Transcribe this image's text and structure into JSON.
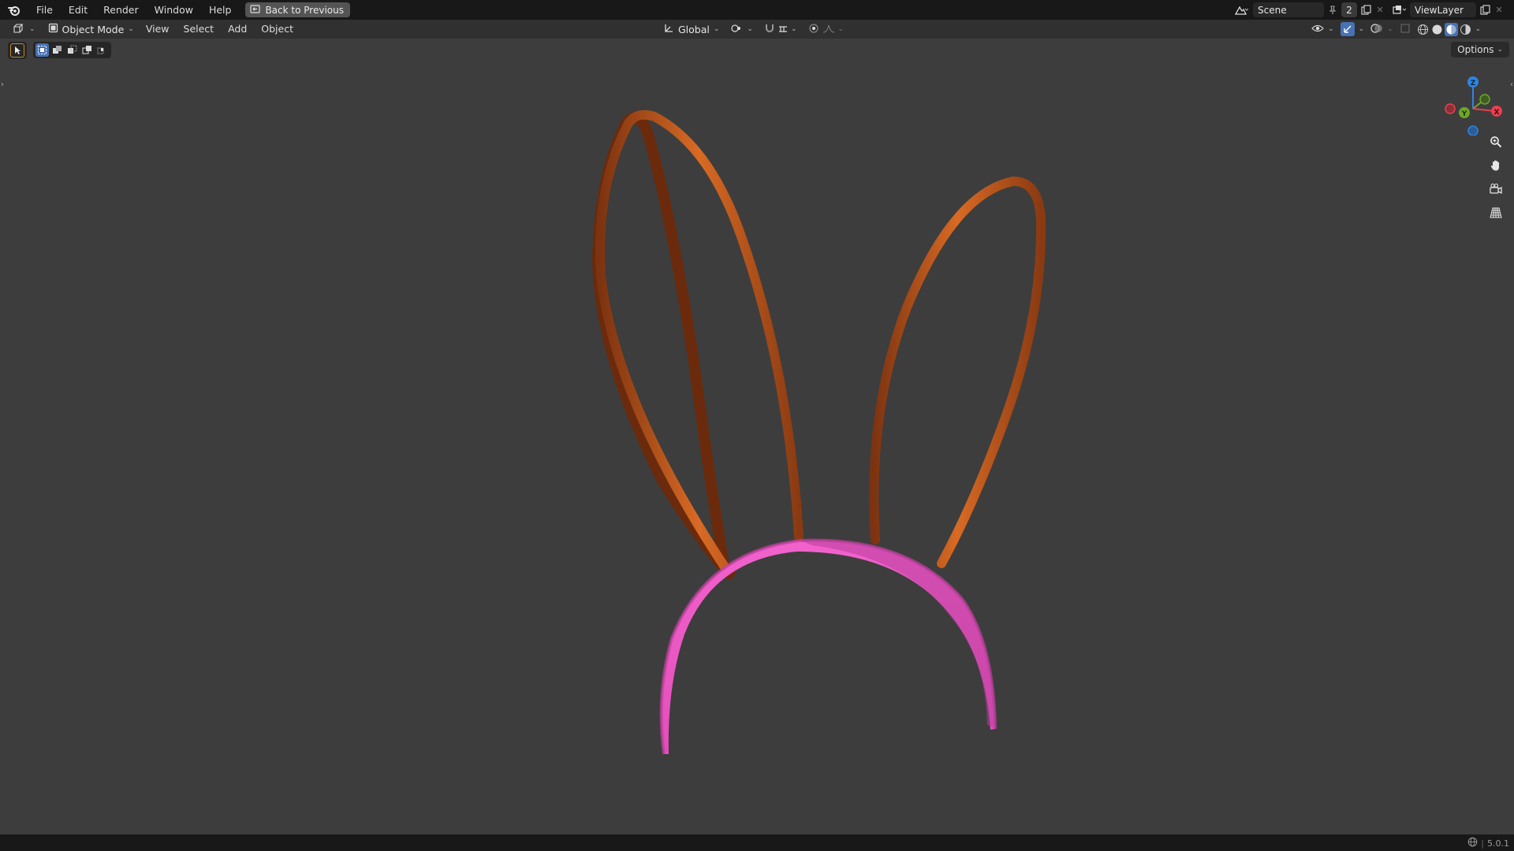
{
  "menu": {
    "file": "File",
    "edit": "Edit",
    "render": "Render",
    "window": "Window",
    "help": "Help",
    "back_to_previous": "Back to Previous"
  },
  "topbar_right": {
    "scene_name": "Scene",
    "scene_users": "2",
    "view_layer": "ViewLayer"
  },
  "header": {
    "mode": "Object Mode",
    "view": "View",
    "select": "Select",
    "add": "Add",
    "object": "Object",
    "orientation": "Global",
    "options": "Options"
  },
  "gizmo": {
    "z": "Z",
    "y": "Y",
    "x": "X",
    "colors": {
      "x": "#e8404f",
      "y": "#6ea62b",
      "z": "#2f84e3"
    }
  },
  "scene_objects": {
    "ears_color": "#c8561a",
    "headband_color": "#f055c4",
    "background_color": "#3d3d3d"
  },
  "status": {
    "version": "5.0.1"
  }
}
